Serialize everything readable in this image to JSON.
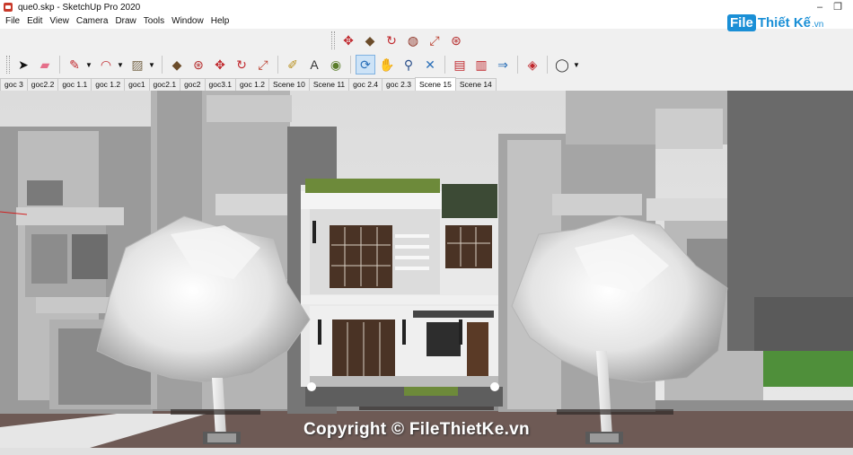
{
  "window": {
    "title": "que0.skp - SketchUp Pro 2020",
    "minimize_symbol": "–",
    "restore_symbol": "❐"
  },
  "menu": [
    "File",
    "Edit",
    "View",
    "Camera",
    "Draw",
    "Tools",
    "Window",
    "Help"
  ],
  "logo": {
    "prefix": "File",
    "main": "Thiết Kế",
    "suffix": ".vn"
  },
  "toolbar_top": [
    {
      "name": "move-icon",
      "glyph": "✥",
      "color": "#c0282d"
    },
    {
      "name": "push-pull-icon",
      "glyph": "◆",
      "color": "#6b4c2a"
    },
    {
      "name": "rotate-icon",
      "glyph": "↻",
      "color": "#c0282d"
    },
    {
      "name": "follow-me-icon",
      "glyph": "◍",
      "color": "#8a2c1e"
    },
    {
      "name": "scale-icon",
      "glyph": "⤢",
      "color": "#b83a2a"
    },
    {
      "name": "offset-icon",
      "glyph": "⊛",
      "color": "#b52b2b"
    }
  ],
  "toolbar_main": [
    {
      "name": "select-icon",
      "glyph": "➤",
      "color": "#111111"
    },
    {
      "name": "eraser-icon",
      "glyph": "▰",
      "color": "#e56f8a"
    },
    {
      "name": "line-icon",
      "glyph": "✎",
      "color": "#c0282d"
    },
    {
      "name": "arc-icon",
      "glyph": "◠",
      "color": "#c0282d"
    },
    {
      "name": "rectangle-icon",
      "glyph": "▨",
      "color": "#7a6a4e"
    },
    {
      "name": "push-pull-main-icon",
      "glyph": "◆",
      "color": "#6b4c2a"
    },
    {
      "name": "follow-me-main-icon",
      "glyph": "⊛",
      "color": "#b52b2b"
    },
    {
      "name": "move-main-icon",
      "glyph": "✥",
      "color": "#c0282d"
    },
    {
      "name": "rotate-main-icon",
      "glyph": "↻",
      "color": "#c0282d"
    },
    {
      "name": "scale-main-icon",
      "glyph": "⤢",
      "color": "#b83a2a"
    },
    {
      "name": "tape-measure-icon",
      "glyph": "✐",
      "color": "#b8901e"
    },
    {
      "name": "text-icon",
      "glyph": "A",
      "color": "#333333"
    },
    {
      "name": "paint-bucket-icon",
      "glyph": "◉",
      "color": "#5a7d2a"
    },
    {
      "name": "orbit-icon",
      "glyph": "⟳",
      "color": "#2a6fb8"
    },
    {
      "name": "pan-icon",
      "glyph": "✋",
      "color": "#d8a84a"
    },
    {
      "name": "zoom-icon",
      "glyph": "⚲",
      "color": "#2a4f8a"
    },
    {
      "name": "zoom-extents-icon",
      "glyph": "✕",
      "color": "#2a6fb8"
    },
    {
      "name": "warehouse-icon",
      "glyph": "▤",
      "color": "#c0282d"
    },
    {
      "name": "extension-warehouse-icon",
      "glyph": "▥",
      "color": "#c0282d"
    },
    {
      "name": "send-to-layout-icon",
      "glyph": "⇒",
      "color": "#2a6fb8"
    },
    {
      "name": "ruby-console-icon",
      "glyph": "◈",
      "color": "#c0282d"
    },
    {
      "name": "profile-icon",
      "glyph": "◯",
      "color": "#333333"
    }
  ],
  "scenes": [
    "goc 3",
    "goc2.2",
    "goc 1.1",
    "goc 1.2",
    "goc1",
    "goc2.1",
    "goc2",
    "goc3.1",
    "goc 1.2",
    "Scene 10",
    "Scene 11",
    "goc 2.4",
    "goc 2.3",
    "Scene 15",
    "Scene 14"
  ],
  "active_scene_index": 13,
  "watermark": "Copyright © FileThietKe.vn"
}
